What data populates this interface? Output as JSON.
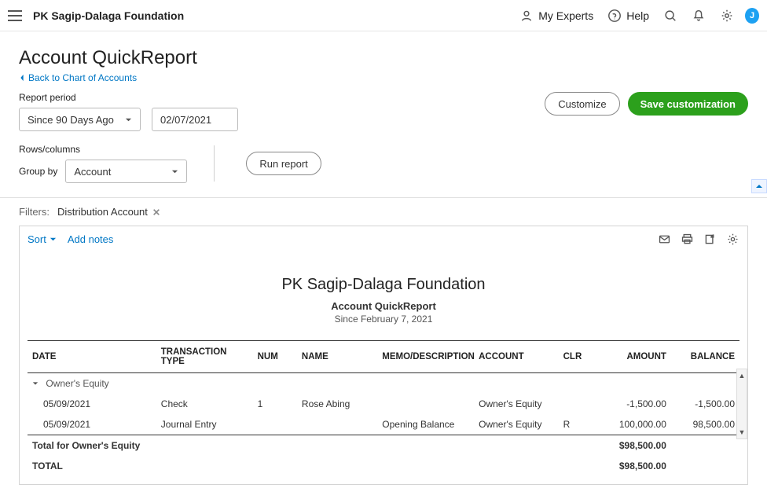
{
  "topbar": {
    "company": "PK Sagip-Dalaga Foundation",
    "experts": "My Experts",
    "help": "Help",
    "avatar_letter": "J"
  },
  "page": {
    "title": "Account QuickReport",
    "back_link": "Back to Chart of Accounts",
    "report_period_label": "Report period",
    "since_select": "Since 90 Days Ago",
    "date_value": "02/07/2021",
    "rows_columns_label": "Rows/columns",
    "group_by_label": "Group by",
    "group_by_value": "Account",
    "run_report": "Run report",
    "customize": "Customize",
    "save": "Save customization"
  },
  "filters": {
    "label": "Filters:",
    "chip": "Distribution Account"
  },
  "card": {
    "sort": "Sort",
    "add_notes": "Add notes"
  },
  "report": {
    "title": "PK Sagip-Dalaga Foundation",
    "subtitle": "Account QuickReport",
    "period": "Since February 7, 2021",
    "cols": {
      "date": "DATE",
      "ttype": "TRANSACTION TYPE",
      "num": "NUM",
      "name": "NAME",
      "memo": "MEMO/DESCRIPTION",
      "account": "ACCOUNT",
      "clr": "CLR",
      "amount": "AMOUNT",
      "balance": "BALANCE"
    },
    "section": "Owner's Equity",
    "rows": [
      {
        "date": "05/09/2021",
        "ttype": "Check",
        "num": "1",
        "name": "Rose Abing",
        "memo": "",
        "account": "Owner's Equity",
        "clr": "",
        "amount": "-1,500.00",
        "balance": "-1,500.00"
      },
      {
        "date": "05/09/2021",
        "ttype": "Journal Entry",
        "num": "",
        "name": "",
        "memo": "Opening Balance",
        "account": "Owner's Equity",
        "clr": "R",
        "amount": "100,000.00",
        "balance": "98,500.00"
      }
    ],
    "total_label": "Total for Owner's Equity",
    "total_amount": "$98,500.00",
    "grand_label": "TOTAL",
    "grand_amount": "$98,500.00"
  }
}
